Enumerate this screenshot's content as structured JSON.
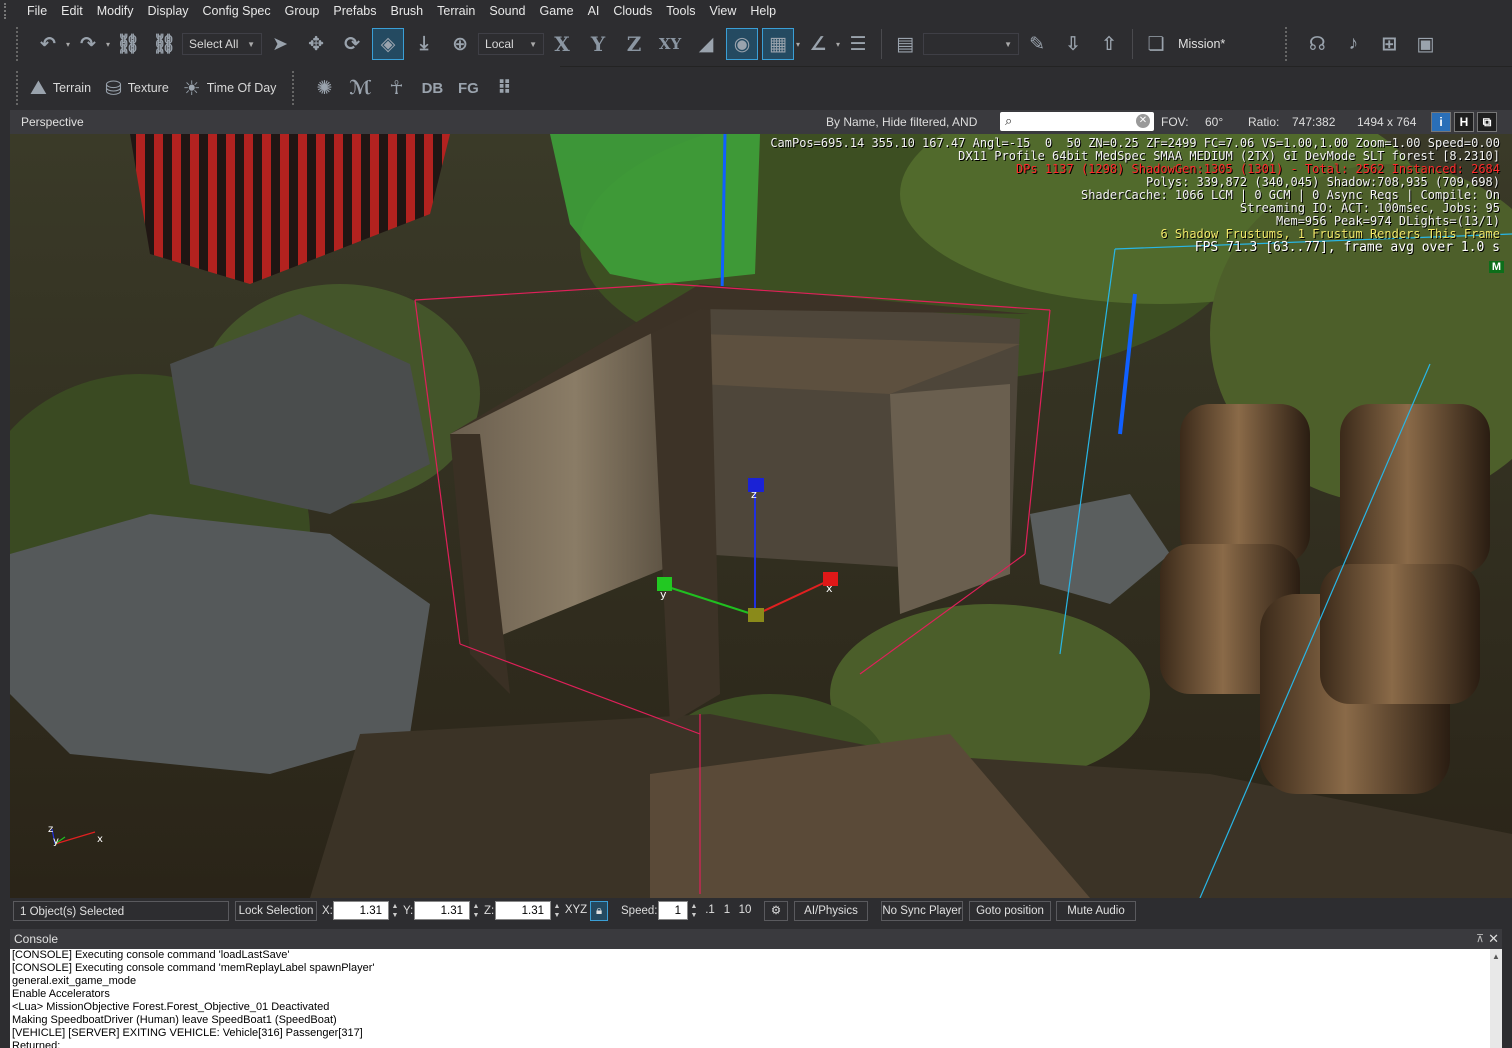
{
  "menu": [
    "File",
    "Edit",
    "Modify",
    "Display",
    "Config Spec",
    "Group",
    "Prefabs",
    "Brush",
    "Terrain",
    "Sound",
    "Game",
    "AI",
    "Clouds",
    "Tools",
    "View",
    "Help"
  ],
  "toolbar1": {
    "select_all": "Select All",
    "coord_space": "Local",
    "axis_x": "X",
    "axis_y": "Y",
    "axis_z": "Z",
    "axis_xy": "XY",
    "mission_label": "Mission*"
  },
  "toolbar2": {
    "terrain_label": "Terrain",
    "texture_label": "Texture",
    "time_of_day_label": "Time Of Day",
    "db_label": "DB",
    "fg_label": "FG"
  },
  "viewport_header": {
    "title": "Perspective",
    "filter_text": "By Name, Hide filtered, AND",
    "search_value": "",
    "fov_label": "FOV:",
    "fov_value": "60°",
    "ratio_label": "Ratio:",
    "ratio_value": "747:382",
    "resolution": "1494 x 764",
    "btn_info": "i",
    "btn_h": "H"
  },
  "hud": {
    "line1": "CamPos=695.14 355.10 167.47 Angl=-15  0  50 ZN=0.25 ZF=2499 FC=7.06 VS=1.00,1.00 Zoom=1.00 Speed=0.00",
    "line2": "DX11 Profile 64bit MedSpec SMAA MEDIUM (2TX) GI DevMode SLT forest [8.2310]",
    "line3": "DPs 1137 (1298) ShadowGen:1305 (1301) - Total: 2562 Instanced: 2684",
    "line4": "Polys: 339,872 (340,045) Shadow:708,935 (709,698)",
    "line5": "ShaderCache: 1066 LCM | 0 GCM | 0 Async Reqs | Compile: On",
    "line6": "Streaming IO: ACT: 100msec, Jobs: 95",
    "line7": "Mem=956 Peak=974 DLights=(13/1)",
    "line8": "6 Shadow Frustums, 1 Frustum Renders This Frame",
    "line9": "FPS 71.3 [63..77], frame avg over 1.0 s",
    "badge": "M"
  },
  "gizmo": {
    "x": "x",
    "y": "y",
    "z": "z"
  },
  "statusbar": {
    "selection": "1 Object(s) Selected",
    "lock_selection": "Lock Selection",
    "x_label": "X:",
    "x_value": "1.31",
    "y_label": "Y:",
    "y_value": "1.31",
    "z_label": "Z:",
    "z_value": "1.31",
    "xyz": "XYZ",
    "speed_label": "Speed:",
    "speed_value": "1",
    "speed_opt1": ".1",
    "speed_opt2": "1",
    "speed_opt3": "10",
    "ai_physics": "AI/Physics",
    "no_sync_player": "No Sync Player",
    "goto_position": "Goto position",
    "mute_audio": "Mute Audio"
  },
  "console": {
    "title": "Console",
    "lines": [
      "[CONSOLE] Executing console command 'loadLastSave'",
      "[CONSOLE] Executing console command 'memReplayLabel spawnPlayer'",
      "general.exit_game_mode",
      "Enable Accelerators",
      "<Lua> MissionObjective Forest.Forest_Objective_01 Deactivated",
      "Making SpeedboatDriver (Human) leave SpeedBoat1 (SpeedBoat)",
      "[VEHICLE] [SERVER] EXITING VEHICLE:  Vehicle[316] Passenger[317]",
      "Returned:"
    ]
  },
  "colors": {
    "panel_bg": "#2d2d30",
    "active_tool": "#3a9fd6",
    "selection_box": "#e0205a",
    "gizmo_x": "#e02020",
    "gizmo_y": "#20c020",
    "gizmo_z": "#2030e0"
  }
}
